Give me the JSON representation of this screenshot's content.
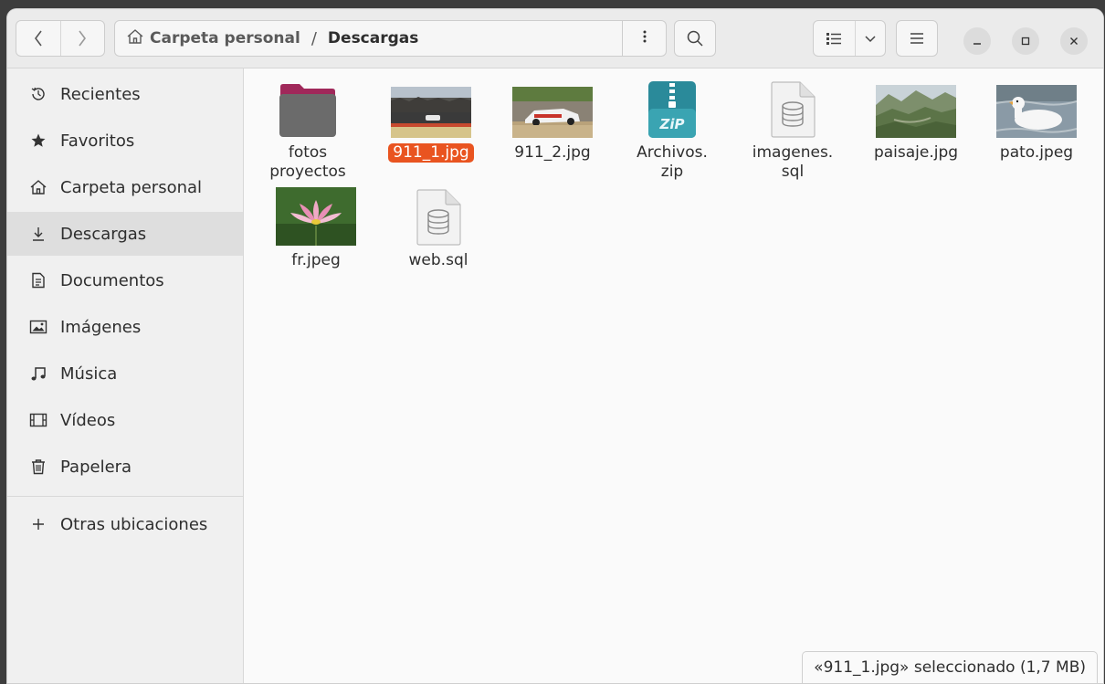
{
  "headerbar": {
    "back_icon": "chevron-left-icon",
    "forward_icon": "chevron-right-icon",
    "path": {
      "home_label": "Carpeta personal",
      "separator": "/",
      "current": "Descargas"
    },
    "path_menu_icon": "vertical-dots-icon",
    "search_icon": "search-icon",
    "view_icon": "list-view-icon",
    "view_dropdown_icon": "chevron-down-icon",
    "menu_icon": "hamburger-menu-icon",
    "window_controls": [
      "minimize",
      "maximize",
      "close"
    ]
  },
  "sidebar": {
    "items": [
      {
        "label": "Recientes",
        "icon": "clock-icon"
      },
      {
        "label": "Favoritos",
        "icon": "star-icon"
      },
      {
        "label": "Carpeta personal",
        "icon": "home-icon"
      },
      {
        "label": "Descargas",
        "icon": "download-icon",
        "active": true
      },
      {
        "label": "Documentos",
        "icon": "document-icon"
      },
      {
        "label": "Imágenes",
        "icon": "image-icon"
      },
      {
        "label": "Música",
        "icon": "music-icon"
      },
      {
        "label": "Vídeos",
        "icon": "film-icon"
      },
      {
        "label": "Papelera",
        "icon": "trash-icon"
      }
    ],
    "other_locations": {
      "label": "Otras ubicaciones",
      "icon": "plus-icon"
    }
  },
  "files": [
    {
      "name": "fotos\nproyectos",
      "type": "folder"
    },
    {
      "name": "911_1.jpg",
      "type": "image",
      "selected": true
    },
    {
      "name": "911_2.jpg",
      "type": "image"
    },
    {
      "name": "Archivos.\nzip",
      "type": "zip"
    },
    {
      "name": "imagenes.\nsql",
      "type": "sql"
    },
    {
      "name": "paisaje.jpg",
      "type": "image"
    },
    {
      "name": "pato.jpeg",
      "type": "image"
    },
    {
      "name": "fr.jpeg",
      "type": "image"
    },
    {
      "name": "web.sql",
      "type": "sql"
    }
  ],
  "zip_label": "ZiP",
  "status": "«911_1.jpg» seleccionado  (1,7 MB)",
  "colors": {
    "accent": "#e95420",
    "folder": "#6b6b6b",
    "folder_tab": "#a0285a",
    "zip": "#2a8a9a"
  }
}
